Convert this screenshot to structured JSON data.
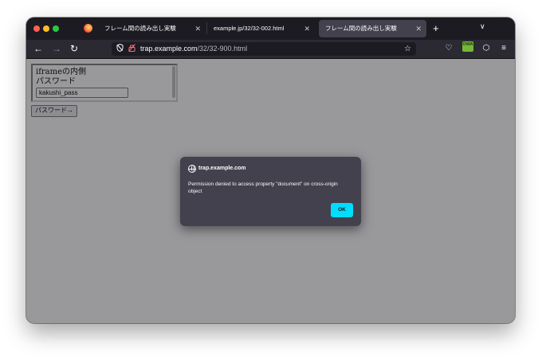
{
  "browser": {
    "tabs": [
      {
        "title": "フレーム間の読み出し実験",
        "close": "✕",
        "active": false
      },
      {
        "title": "example.jp/32/32-002.html",
        "close": "✕",
        "active": false
      },
      {
        "title": "フレーム間の読み出し実験",
        "close": "✕",
        "active": true
      }
    ],
    "new_tab": "+",
    "tab_list": "∨",
    "address": {
      "host": "trap.example.com",
      "path": "/32/32-900.html"
    },
    "nav": {
      "back": "←",
      "forward": "→",
      "reload": "↻"
    },
    "toolbar_icons": {
      "star": "☆",
      "pocket": "♡",
      "extension": "OWA",
      "puzzle": "⬡",
      "menu": "≡"
    }
  },
  "page": {
    "iframe": {
      "heading": "iframeの内側",
      "label": "パスワード",
      "input_value": "kakushi_pass"
    },
    "button_label": "パスワード→"
  },
  "dialog": {
    "origin": "trap.example.com",
    "message": "Permission denied to access property \"document\" on cross-origin object",
    "ok_label": "OK"
  },
  "colors": {
    "accent": "#00ddff",
    "tabbar": "#1c1b22",
    "dialog_bg": "#42414d"
  }
}
